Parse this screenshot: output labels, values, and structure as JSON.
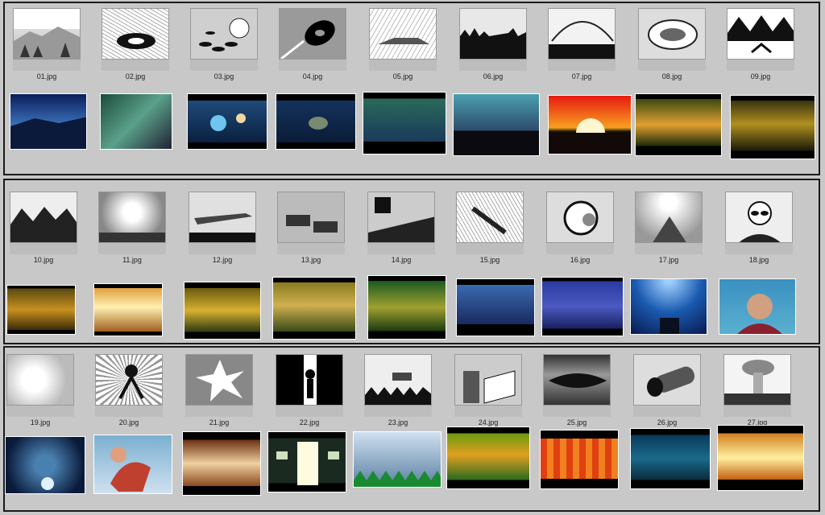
{
  "rows": [
    {
      "sketch_captions": [
        "01.jpg",
        "02.jpg",
        "03.jpg",
        "04.jpg",
        "05.jpg",
        "06.jpg",
        "07.jpg",
        "08.jpg",
        "09.jpg"
      ]
    },
    {
      "sketch_captions": [
        "10.jpg",
        "11.jpg",
        "12.jpg",
        "13.jpg",
        "14.jpg",
        "15.jpg",
        "16.jpg",
        "17.jpg",
        "18.jpg"
      ]
    },
    {
      "sketch_captions": [
        "19.jpg",
        "20.jpg",
        "21.jpg",
        "22.jpg",
        "23.jpg",
        "24.jpg",
        "25.jpg",
        "26.jpg",
        "27.jpg"
      ]
    }
  ],
  "colors": {
    "background": "#c8c8c8",
    "frame_border": "#1a1a1a"
  }
}
